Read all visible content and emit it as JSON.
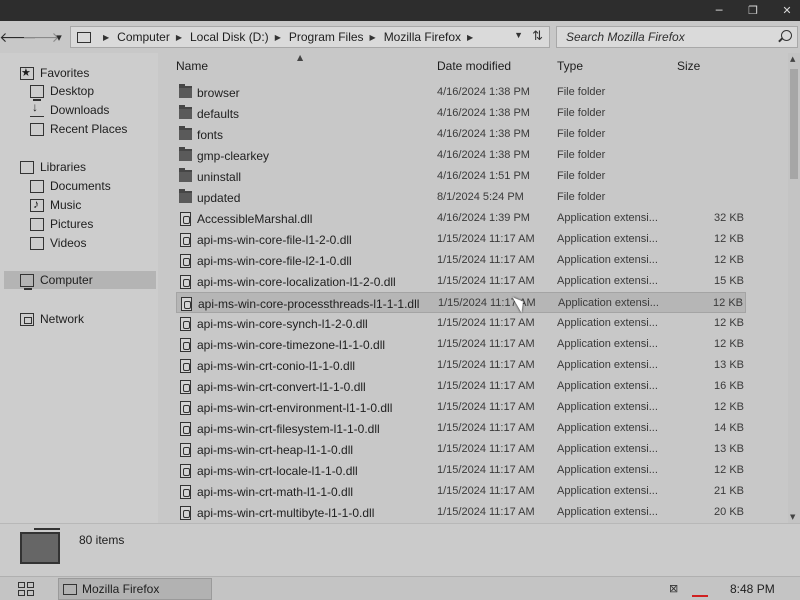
{
  "window": {
    "minimize_glyph": "─",
    "maximize_glyph": "❐",
    "close_glyph": "✕"
  },
  "toolbar": {
    "back_glyph": "🡐",
    "forward_glyph": "🡒",
    "recent_glyph": "▾",
    "breadcrumbs": [
      "Computer",
      "Local Disk (D:)",
      "Program Files",
      "Mozilla Firefox"
    ],
    "refresh_glyph": "⇅",
    "search_placeholder": "Search Mozilla Firefox"
  },
  "sidebar": {
    "groups": [
      {
        "label": "Favorites",
        "icon": "star-icon",
        "items": [
          {
            "label": "Desktop",
            "icon": "desktop-icon"
          },
          {
            "label": "Downloads",
            "icon": "downloads-icon"
          },
          {
            "label": "Recent Places",
            "icon": "recent-places-icon"
          }
        ]
      },
      {
        "label": "Libraries",
        "icon": "libraries-icon",
        "items": [
          {
            "label": "Documents",
            "icon": "documents-icon"
          },
          {
            "label": "Music",
            "icon": "music-icon"
          },
          {
            "label": "Pictures",
            "icon": "pictures-icon"
          },
          {
            "label": "Videos",
            "icon": "videos-icon"
          }
        ]
      },
      {
        "label": "Computer",
        "icon": "computer-icon",
        "items": []
      },
      {
        "label": "Network",
        "icon": "network-icon",
        "items": []
      }
    ]
  },
  "columns": {
    "name": "Name",
    "date": "Date modified",
    "type": "Type",
    "size": "Size"
  },
  "files": [
    {
      "name": "browser",
      "date": "4/16/2024 1:38 PM",
      "type": "File folder",
      "size": "",
      "kind": "folder"
    },
    {
      "name": "defaults",
      "date": "4/16/2024 1:38 PM",
      "type": "File folder",
      "size": "",
      "kind": "folder"
    },
    {
      "name": "fonts",
      "date": "4/16/2024 1:38 PM",
      "type": "File folder",
      "size": "",
      "kind": "folder"
    },
    {
      "name": "gmp-clearkey",
      "date": "4/16/2024 1:38 PM",
      "type": "File folder",
      "size": "",
      "kind": "folder"
    },
    {
      "name": "uninstall",
      "date": "4/16/2024 1:51 PM",
      "type": "File folder",
      "size": "",
      "kind": "folder"
    },
    {
      "name": "updated",
      "date": "8/1/2024 5:24 PM",
      "type": "File folder",
      "size": "",
      "kind": "folder"
    },
    {
      "name": "AccessibleMarshal.dll",
      "date": "4/16/2024 1:39 PM",
      "type": "Application extensi...",
      "size": "32 KB",
      "kind": "dll"
    },
    {
      "name": "api-ms-win-core-file-l1-2-0.dll",
      "date": "1/15/2024 11:17 AM",
      "type": "Application extensi...",
      "size": "12 KB",
      "kind": "dll"
    },
    {
      "name": "api-ms-win-core-file-l2-1-0.dll",
      "date": "1/15/2024 11:17 AM",
      "type": "Application extensi...",
      "size": "12 KB",
      "kind": "dll"
    },
    {
      "name": "api-ms-win-core-localization-l1-2-0.dll",
      "date": "1/15/2024 11:17 AM",
      "type": "Application extensi...",
      "size": "15 KB",
      "kind": "dll"
    },
    {
      "name": "api-ms-win-core-processthreads-l1-1-1.dll",
      "date": "1/15/2024 11:17 AM",
      "type": "Application extensi...",
      "size": "12 KB",
      "kind": "dll",
      "hover": true
    },
    {
      "name": "api-ms-win-core-synch-l1-2-0.dll",
      "date": "1/15/2024 11:17 AM",
      "type": "Application extensi...",
      "size": "12 KB",
      "kind": "dll"
    },
    {
      "name": "api-ms-win-core-timezone-l1-1-0.dll",
      "date": "1/15/2024 11:17 AM",
      "type": "Application extensi...",
      "size": "12 KB",
      "kind": "dll"
    },
    {
      "name": "api-ms-win-crt-conio-l1-1-0.dll",
      "date": "1/15/2024 11:17 AM",
      "type": "Application extensi...",
      "size": "13 KB",
      "kind": "dll"
    },
    {
      "name": "api-ms-win-crt-convert-l1-1-0.dll",
      "date": "1/15/2024 11:17 AM",
      "type": "Application extensi...",
      "size": "16 KB",
      "kind": "dll"
    },
    {
      "name": "api-ms-win-crt-environment-l1-1-0.dll",
      "date": "1/15/2024 11:17 AM",
      "type": "Application extensi...",
      "size": "12 KB",
      "kind": "dll"
    },
    {
      "name": "api-ms-win-crt-filesystem-l1-1-0.dll",
      "date": "1/15/2024 11:17 AM",
      "type": "Application extensi...",
      "size": "14 KB",
      "kind": "dll"
    },
    {
      "name": "api-ms-win-crt-heap-l1-1-0.dll",
      "date": "1/15/2024 11:17 AM",
      "type": "Application extensi...",
      "size": "13 KB",
      "kind": "dll"
    },
    {
      "name": "api-ms-win-crt-locale-l1-1-0.dll",
      "date": "1/15/2024 11:17 AM",
      "type": "Application extensi...",
      "size": "12 KB",
      "kind": "dll"
    },
    {
      "name": "api-ms-win-crt-math-l1-1-0.dll",
      "date": "1/15/2024 11:17 AM",
      "type": "Application extensi...",
      "size": "21 KB",
      "kind": "dll"
    },
    {
      "name": "api-ms-win-crt-multibyte-l1-1-0.dll",
      "date": "1/15/2024 11:17 AM",
      "type": "Application extensi...",
      "size": "20 KB",
      "kind": "dll"
    }
  ],
  "status": {
    "item_count": "80 items"
  },
  "taskbar": {
    "window_label": "Mozilla Firefox",
    "clock": "8:48 PM"
  },
  "colors": {
    "background": "#c8c8c8",
    "titlebar": "#2d2d2d",
    "hover_row": "#b6b6b6"
  }
}
